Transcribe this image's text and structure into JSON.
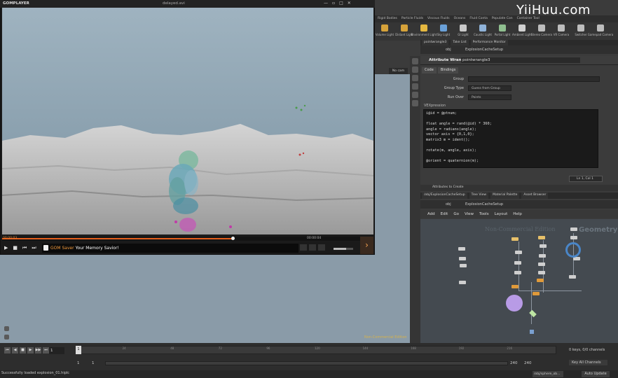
{
  "watermark": "YiiHuu.com",
  "player": {
    "logo": "GOMPLAYER",
    "file": "delayed.avi",
    "time_current": "00:00:03",
    "time_total": "00:00:04",
    "seek_fraction": 0.62,
    "volume_fraction": 0.64,
    "ad_brand": "GOM Saver",
    "ad_tagline": "Your Memory Savior!",
    "next_glyph": "›",
    "controls": [
      "▶",
      "■",
      "⏮",
      "⏭"
    ],
    "window_buttons": [
      "—",
      "▫",
      "□",
      "✕"
    ]
  },
  "houdini": {
    "shelf_tabs": [
      "Rigid Bodies",
      "Particle Fluids",
      "Viscous Fluids",
      "Oceans",
      "Fluid Conta",
      "Populate Con",
      "Container Tool"
    ],
    "shelf_tools": [
      {
        "label": "Volume Light",
        "color": "#d6a23a"
      },
      {
        "label": "Distant Light",
        "color": "#d6a23a"
      },
      {
        "label": "Environment Light",
        "color": "#e5b840"
      },
      {
        "label": "Sky Light",
        "color": "#6aa0d8"
      },
      {
        "label": "GI Light",
        "color": "#c9c9c9"
      },
      {
        "label": "Caustic Light",
        "color": "#8fb2d8"
      },
      {
        "label": "Portal Light",
        "color": "#8fbf8f"
      },
      {
        "label": "Ambient Light",
        "color": "#d0d0d0"
      },
      {
        "label": "Stereo Camera",
        "color": "#bdbdbd"
      },
      {
        "label": "VR Camera",
        "color": "#bdbdbd"
      },
      {
        "label": "Switcher",
        "color": "#bdbdbd"
      },
      {
        "label": "Gamepad Camera",
        "color": "#bdbdbd"
      }
    ],
    "top_pane_tabs": [
      "pointwrangle3",
      "Take List",
      "Performance Monitor"
    ],
    "top_path": "obj",
    "top_node_path": "ExplosionCacheSetup",
    "param_header_type": "Attribute Wrangle",
    "param_header_name": "pointwrangle3",
    "param_tabs": [
      "Code",
      "Bindings"
    ],
    "params": [
      {
        "label": "Group",
        "value": ""
      },
      {
        "label": "Group Type",
        "value": "Guess from Group"
      },
      {
        "label": "Run Over",
        "value": "Points"
      }
    ],
    "vex_label": "VEXpression",
    "code_lines": [
      "i@id = @ptnum;",
      "",
      "float angle = rand(@id) * 360;",
      "angle = radians(angle);",
      "vector axis = {0,1,0};",
      "matrix3 m = ident();",
      "",
      "rotate(m, angle, axis);",
      "",
      "@orient = quaternion(m);"
    ],
    "cursor_info": "Ln 1, Col 1",
    "attr_create": "Attributes to Create",
    "bottom_pane_tabs": [
      "/obj/ExplosionCacheSetup",
      "Tree View",
      "Material Palette",
      "Asset Browser"
    ],
    "bottom_path": "obj",
    "bottom_node_path": "ExplosionCacheSetup",
    "network_menu": [
      "Add",
      "Edit",
      "Go",
      "View",
      "Tools",
      "Layout",
      "Help"
    ],
    "network_watermark": "Non-Commercial Edition",
    "network_context": "Geometry",
    "viewport_cam": "No cam",
    "viewport_label": "Non-Commercial Edition",
    "timeline_ticks": [
      "24",
      "48",
      "72",
      "96",
      "120",
      "144",
      "168",
      "192",
      "216"
    ],
    "current_frame": "1",
    "frame_field": "1",
    "range_start": "1",
    "range_start2": "1",
    "range_end": "240",
    "range_end2": "240",
    "keys_info": "0 keys, 0/0 channels",
    "key_channels": "Key All Channels",
    "status": "Successfully loaded explosion_01.hiplc",
    "status_path": "/obj/sphere_ob...",
    "auto_update": "Auto Update"
  }
}
